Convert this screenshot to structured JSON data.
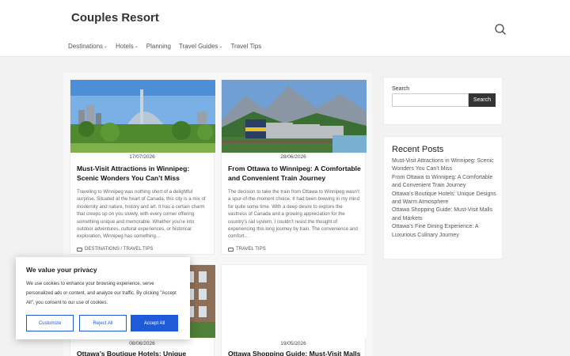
{
  "site": {
    "title": "Couples Resort"
  },
  "nav": [
    {
      "label": "Destinations",
      "dropdown": true
    },
    {
      "label": "Hotels",
      "dropdown": true
    },
    {
      "label": "Planning",
      "dropdown": false
    },
    {
      "label": "Travel Guides",
      "dropdown": true
    },
    {
      "label": "Travel Tips",
      "dropdown": false
    }
  ],
  "posts": [
    {
      "date": "17/07/2026",
      "title": "Must-Visit Attractions in Winnipeg: Scenic Wonders You Can’t Miss",
      "excerpt": "Traveling to Winnipeg was nothing short of a delightful surprise. Situated at the heart of Canada, this city is a mix of modernity and nature, history and art. It has a certain charm that creeps up on you slowly, with every corner offering something unique and memorable. Whether you’re into outdoor adventures, cultural experiences, or historical exploration, Winnipeg has something…",
      "categories": "DESTINATIONS / TRAVEL TIPS"
    },
    {
      "date": "28/06/2026",
      "title": "From Ottawa to Winnipeg: A Comfortable and Convenient Train Journey",
      "excerpt": "The decision to take the train from Ottawa to Winnipeg wasn’t a spur-of-the-moment choice. It had been brewing in my mind for quite some time. With a deep desire to explore the vastness of Canada and a growing appreciation for the country’s rail system, I couldn’t resist the thought of experiencing this long journey by train. The convenience and comfort…",
      "categories": "TRAVEL TIPS"
    },
    {
      "date": "08/06/2026",
      "title": "Ottawa’s Boutique Hotels: Unique Designs"
    },
    {
      "date": "19/05/2026",
      "title": "Ottawa Shopping Guide: Must-Visit Malls"
    }
  ],
  "sidebar": {
    "search_label": "Search",
    "search_value": "",
    "search_button": "Search",
    "recent_heading": "Recent Posts",
    "recent": [
      "Must-Visit Attractions in Winnipeg: Scenic Wonders You Can’t Miss",
      "From Ottawa to Winnipeg: A Comfortable and Convenient Train Journey",
      "Ottawa’s Boutique Hotels: Unique Designs and Warm Atmosphere",
      "Ottawa Shopping Guide: Must-Visit Malls and Markets",
      "Ottawa’s Fine Dining Experience: A Luxurious Culinary Journey"
    ]
  },
  "cookie": {
    "title": "We value your privacy",
    "text": "We use cookies to enhance your browsing experience, serve personalized ads or content, and analyze our traffic. By clicking \"Accept All\", you consent to our use of cookies.",
    "customize": "Customize",
    "reject": "Reject All",
    "accept": "Accept All",
    "accent": "#1f5bd8"
  },
  "icons": {
    "search": "search-icon",
    "folder": "folder-icon",
    "chevron": "chevron-down-icon"
  }
}
